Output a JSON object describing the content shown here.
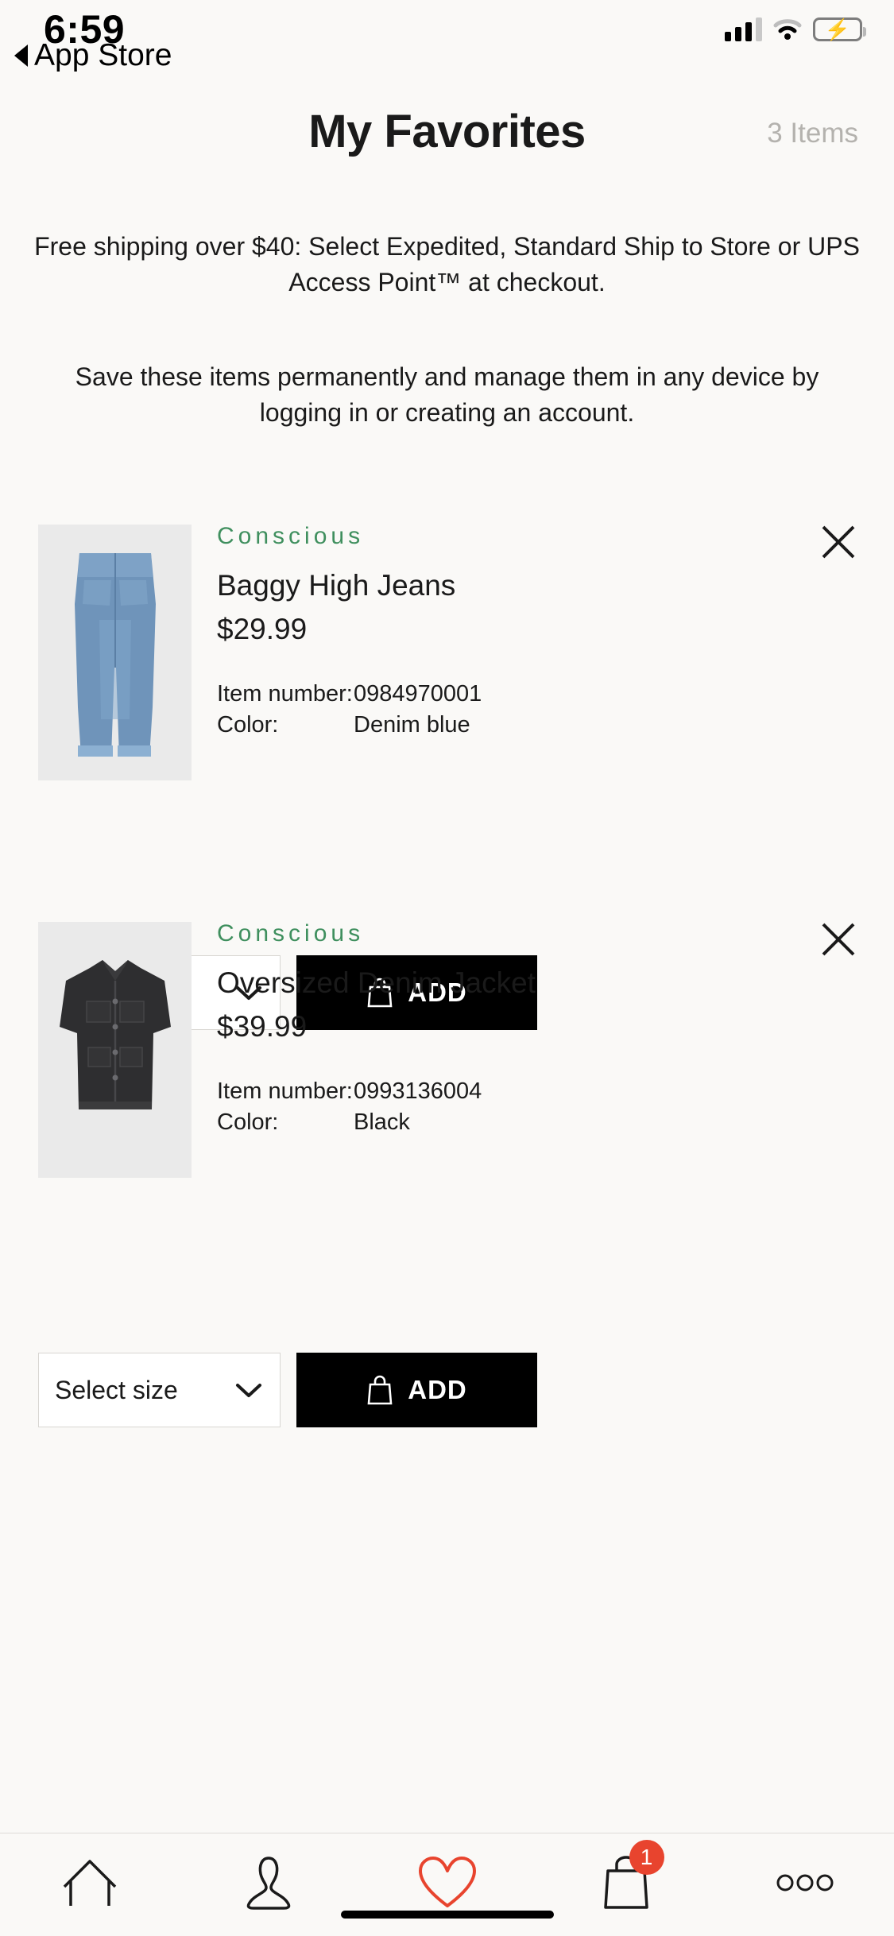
{
  "status_bar": {
    "time": "6:59",
    "back_label": "App Store",
    "icons": [
      "cellular-signal-icon",
      "wifi-icon",
      "battery-charging-icon"
    ]
  },
  "header": {
    "title": "My Favorites",
    "item_count": "3 Items"
  },
  "banners": {
    "shipping": "Free shipping over $40: Select Expedited, Standard Ship to Store or UPS Access Point™ at checkout.",
    "account": "Save these items permanently and manage them in any device by logging in or creating an account."
  },
  "labels": {
    "item_number": "Item number:",
    "color": "Color:",
    "select_size": "Select size",
    "add": "ADD"
  },
  "products": [
    {
      "brand_tag": "Conscious",
      "name": "Baggy High Jeans",
      "price": "$29.99",
      "item_number": "0984970001",
      "color": "Denim blue",
      "image": "jeans-thumbnail"
    },
    {
      "brand_tag": "Conscious",
      "name": "Oversized Denim Jacket",
      "price": "$39.99",
      "item_number": "0993136004",
      "color": "Black",
      "image": "denim-jacket-thumbnail"
    }
  ],
  "tabbar": {
    "items": [
      {
        "icon": "home-icon",
        "active": false
      },
      {
        "icon": "person-icon",
        "active": false
      },
      {
        "icon": "heart-icon",
        "active": true
      },
      {
        "icon": "shopping-bag-icon",
        "active": false,
        "badge": "1"
      },
      {
        "icon": "more-dots-icon",
        "active": false
      }
    ]
  },
  "colors": {
    "background": "#faf9f7",
    "accent_green": "#3f8f5e",
    "accent_red": "#e8442e",
    "button_black": "#000000",
    "muted_text": "#b4b2ae"
  }
}
